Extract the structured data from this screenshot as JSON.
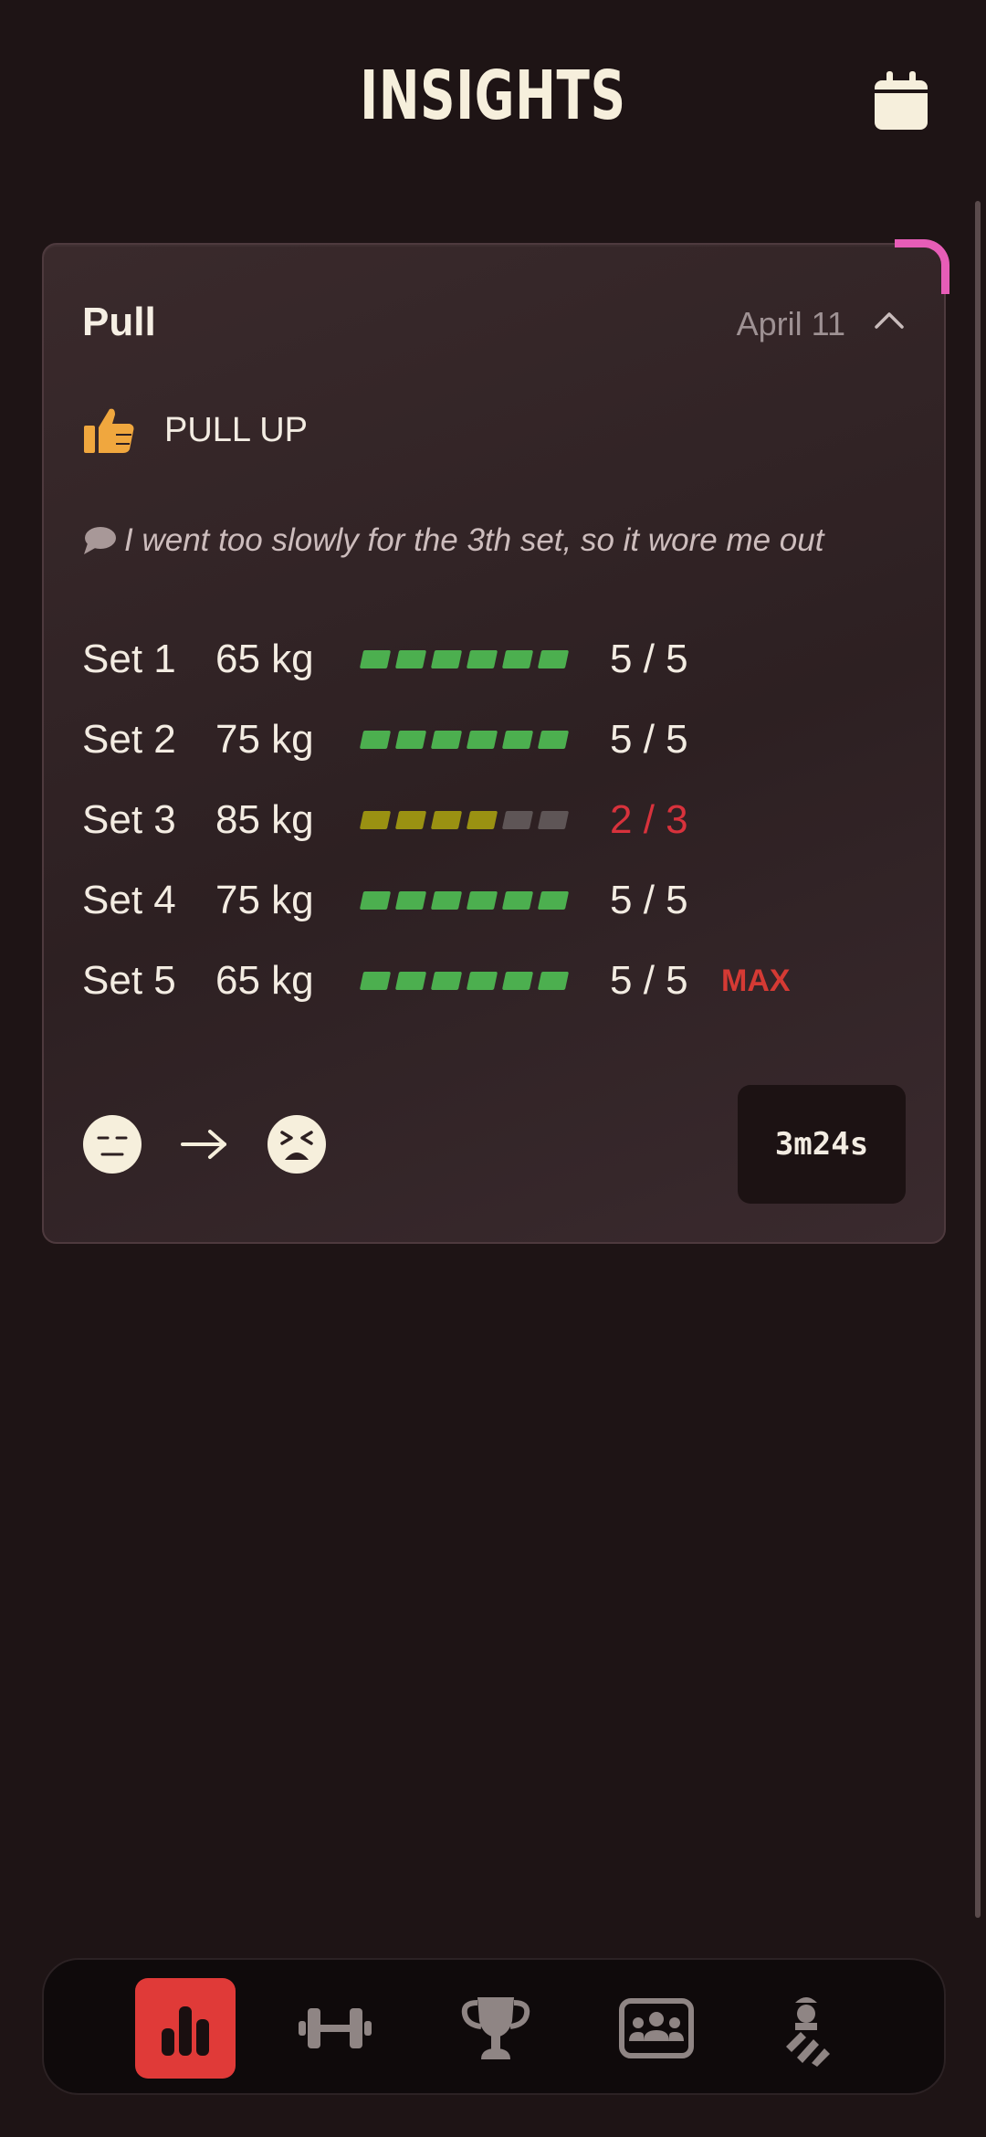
{
  "header": {
    "title": "INSIGHTS"
  },
  "workout": {
    "name": "Pull",
    "date": "April 11",
    "exercise": {
      "name": "PULL UP",
      "rating_icon": "thumbs-up-icon"
    },
    "note": "I went too slowly for the 3th set, so it wore me out",
    "sets": [
      {
        "label": "Set 1",
        "weight": "65 kg",
        "reps": "5 / 5",
        "progress": 1.0,
        "status": "complete"
      },
      {
        "label": "Set 2",
        "weight": "75 kg",
        "reps": "5 / 5",
        "progress": 1.0,
        "status": "complete"
      },
      {
        "label": "Set 3",
        "weight": "85 kg",
        "reps": "2 / 3",
        "progress": 0.67,
        "status": "failed"
      },
      {
        "label": "Set 4",
        "weight": "75 kg",
        "reps": "5 / 5",
        "progress": 1.0,
        "status": "complete"
      },
      {
        "label": "Set 5",
        "weight": "65 kg",
        "reps": "5 / 5",
        "progress": 1.0,
        "status": "complete",
        "badge": "MAX"
      }
    ],
    "mood": {
      "before": "neutral-face-icon",
      "after": "tired-face-icon"
    },
    "duration": "3m24s"
  },
  "nav": {
    "items": [
      {
        "name": "insights",
        "icon": "bar-chart-icon",
        "active": true
      },
      {
        "name": "workouts",
        "icon": "dumbbell-icon",
        "active": false
      },
      {
        "name": "records",
        "icon": "trophy-icon",
        "active": false
      },
      {
        "name": "community",
        "icon": "group-icon",
        "active": false
      },
      {
        "name": "profile",
        "icon": "lifter-icon",
        "active": false
      }
    ]
  },
  "colors": {
    "background": "#1e1415",
    "accent": "#e03a38",
    "corner_accent": "#e75db7",
    "set_complete": "#4caf4f",
    "set_partial": "#9a9112",
    "set_fail_text": "#d8323c",
    "max_badge": "#d53a34"
  }
}
